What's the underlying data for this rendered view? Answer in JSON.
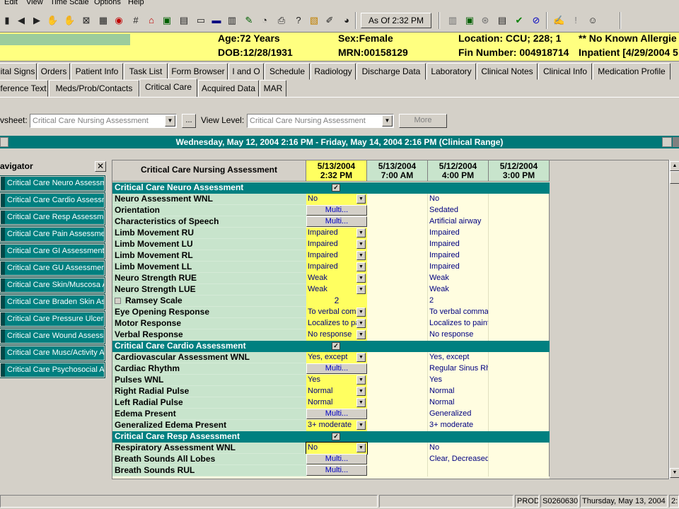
{
  "menu": {
    "items": [
      "Edit",
      "View",
      "Time Scale",
      "Options",
      "Help"
    ]
  },
  "toolbar": {
    "as_of_label": "As Of  2:32 PM"
  },
  "banner": {
    "age": "Age:72 Years",
    "sex": "Sex:Female",
    "location": "Location: CCU; 228; 1",
    "allergies": "** No Known Allergie",
    "dob": "DOB:12/28/1931",
    "mrn": "MRN:00158129",
    "fin": "Fin Number: 004918714",
    "inpatient": "Inpatient [4/29/2004 5"
  },
  "tabs_row1": [
    "ital Signs",
    "Orders",
    "Patient Info",
    "Task List",
    "Form Browser",
    "I and O",
    "Schedule",
    "Radiology",
    "Discharge Data",
    "Laboratory",
    "Clinical Notes",
    "Clinical Info",
    "Medication Profile"
  ],
  "tabs_row2": [
    "ference Text",
    "Meds/Prob/Contacts",
    "Critical Care",
    "Acquired Data",
    "MAR"
  ],
  "selector": {
    "worksheet_label": "vsheet:",
    "worksheet_value": "Critical Care Nursing Assessment",
    "browse_label": "...",
    "view_level_label": "View Level:",
    "view_level_value": "Critical Care Nursing Assessment",
    "more_label": "More"
  },
  "range_bar": "Wednesday, May 12, 2004 2:16 PM - Friday, May 14, 2004 2:16 PM (Clinical Range)",
  "navigator": {
    "title": "avigator",
    "items": [
      "Critical Care Neuro Assessme",
      "Critical Care Cardio Assessme",
      "Critical Care Resp Assessmen",
      "Critical Care Pain Assessmen",
      "Critical Care GI Assessment",
      "Critical Care GU Assessment",
      "Critical Care Skin/Muscosa A",
      "Critical Care Braden Skin Ass",
      "Critical Care Pressure Ulcer",
      "Critical Care Wound Assessm",
      "Critical Care Musc/Activity As",
      "Critical Care Psychosocial As"
    ]
  },
  "grid": {
    "title": "Critical Care Nursing Assessment",
    "columns": [
      {
        "date": "5/13/2004",
        "time": "2:32 PM"
      },
      {
        "date": "5/13/2004",
        "time": "7:00 AM"
      },
      {
        "date": "5/12/2004",
        "time": "4:00 PM"
      },
      {
        "date": "5/12/2004",
        "time": "3:00 PM"
      }
    ],
    "rows": [
      {
        "type": "section",
        "label": "Critical Care Neuro Assessment"
      },
      {
        "type": "row",
        "label": "Neuro Assessment WNL",
        "entry": "No",
        "entry_kind": "dropdown",
        "col3": "No"
      },
      {
        "type": "row",
        "label": "Orientation",
        "entry": "Multi...",
        "entry_kind": "multi",
        "col3": "Sedated"
      },
      {
        "type": "row",
        "label": "Characteristics of Speech",
        "entry": "Multi...",
        "entry_kind": "multi",
        "col3": "Artificial airway"
      },
      {
        "type": "row",
        "label": "Limb Movement RU",
        "entry": "Impaired",
        "entry_kind": "dropdown",
        "col3": "Impaired"
      },
      {
        "type": "row",
        "label": "Limb Movement LU",
        "entry": "Impaired",
        "entry_kind": "dropdown",
        "col3": "Impaired"
      },
      {
        "type": "row",
        "label": "Limb Movement RL",
        "entry": "Impaired",
        "entry_kind": "dropdown",
        "col3": "Impaired"
      },
      {
        "type": "row",
        "label": "Limb Movement LL",
        "entry": "Impaired",
        "entry_kind": "dropdown",
        "col3": "Impaired"
      },
      {
        "type": "row",
        "label": "Neuro Strength RUE",
        "entry": "Weak",
        "entry_kind": "dropdown",
        "col3": "Weak"
      },
      {
        "type": "row",
        "label": "Neuro Strength LUE",
        "entry": "Weak",
        "entry_kind": "dropdown",
        "col3": "Weak"
      },
      {
        "type": "row",
        "label": "Ramsey Scale",
        "entry": "2",
        "entry_kind": "number",
        "col3": "2",
        "expand": true
      },
      {
        "type": "row",
        "label": "Eye Opening Response",
        "entry": "To verbal com",
        "entry_kind": "dropdown",
        "col3": "To verbal comma"
      },
      {
        "type": "row",
        "label": "Motor Response",
        "entry": "Localizes to pa",
        "entry_kind": "dropdown",
        "col3": "Localizes to painf"
      },
      {
        "type": "row",
        "label": "Verbal Response",
        "entry": "No response",
        "entry_kind": "dropdown",
        "col3": "No response"
      },
      {
        "type": "section",
        "label": "Critical Care Cardio Assessment"
      },
      {
        "type": "row",
        "label": "Cardiovascular Assessment WNL",
        "entry": "Yes, except",
        "entry_kind": "dropdown",
        "col3": "Yes, except"
      },
      {
        "type": "row",
        "label": "Cardiac Rhythm",
        "entry": "Multi...",
        "entry_kind": "multi",
        "col3": "Regular Sinus Rh"
      },
      {
        "type": "row",
        "label": "Pulses WNL",
        "entry": "Yes",
        "entry_kind": "dropdown",
        "col3": "Yes"
      },
      {
        "type": "row",
        "label": "Right Radial Pulse",
        "entry": "Normal",
        "entry_kind": "dropdown",
        "col3": "Normal"
      },
      {
        "type": "row",
        "label": "Left Radial Pulse",
        "entry": "Normal",
        "entry_kind": "dropdown",
        "col3": "Normal"
      },
      {
        "type": "row",
        "label": "Edema Present",
        "entry": "Multi...",
        "entry_kind": "multi",
        "col3": "Generalized"
      },
      {
        "type": "row",
        "label": "Generalized Edema Present",
        "entry": "3+ moderate",
        "entry_kind": "dropdown",
        "col3": "3+ moderate"
      },
      {
        "type": "section",
        "label": "Critical Care Resp Assessment"
      },
      {
        "type": "row",
        "label": "Respiratory Assessment WNL",
        "entry": "No",
        "entry_kind": "dropdown",
        "col3": "No",
        "focused": true
      },
      {
        "type": "row",
        "label": "Breath Sounds All Lobes",
        "entry": "Multi...",
        "entry_kind": "multi",
        "col3": "Clear, Decreased"
      },
      {
        "type": "row",
        "label": "Breath Sounds RUL",
        "entry": "Multi...",
        "entry_kind": "multi",
        "col3": ""
      }
    ]
  },
  "status_bar": {
    "env": "PROD",
    "user": "S0260630",
    "date": "Thursday, May 13, 2004",
    "extra": "2:"
  },
  "colors": {
    "teal": "#008080",
    "banner_yellow": "#ffff80",
    "label_green": "#c8e4cc",
    "entry_yellow": "#ffff60"
  }
}
